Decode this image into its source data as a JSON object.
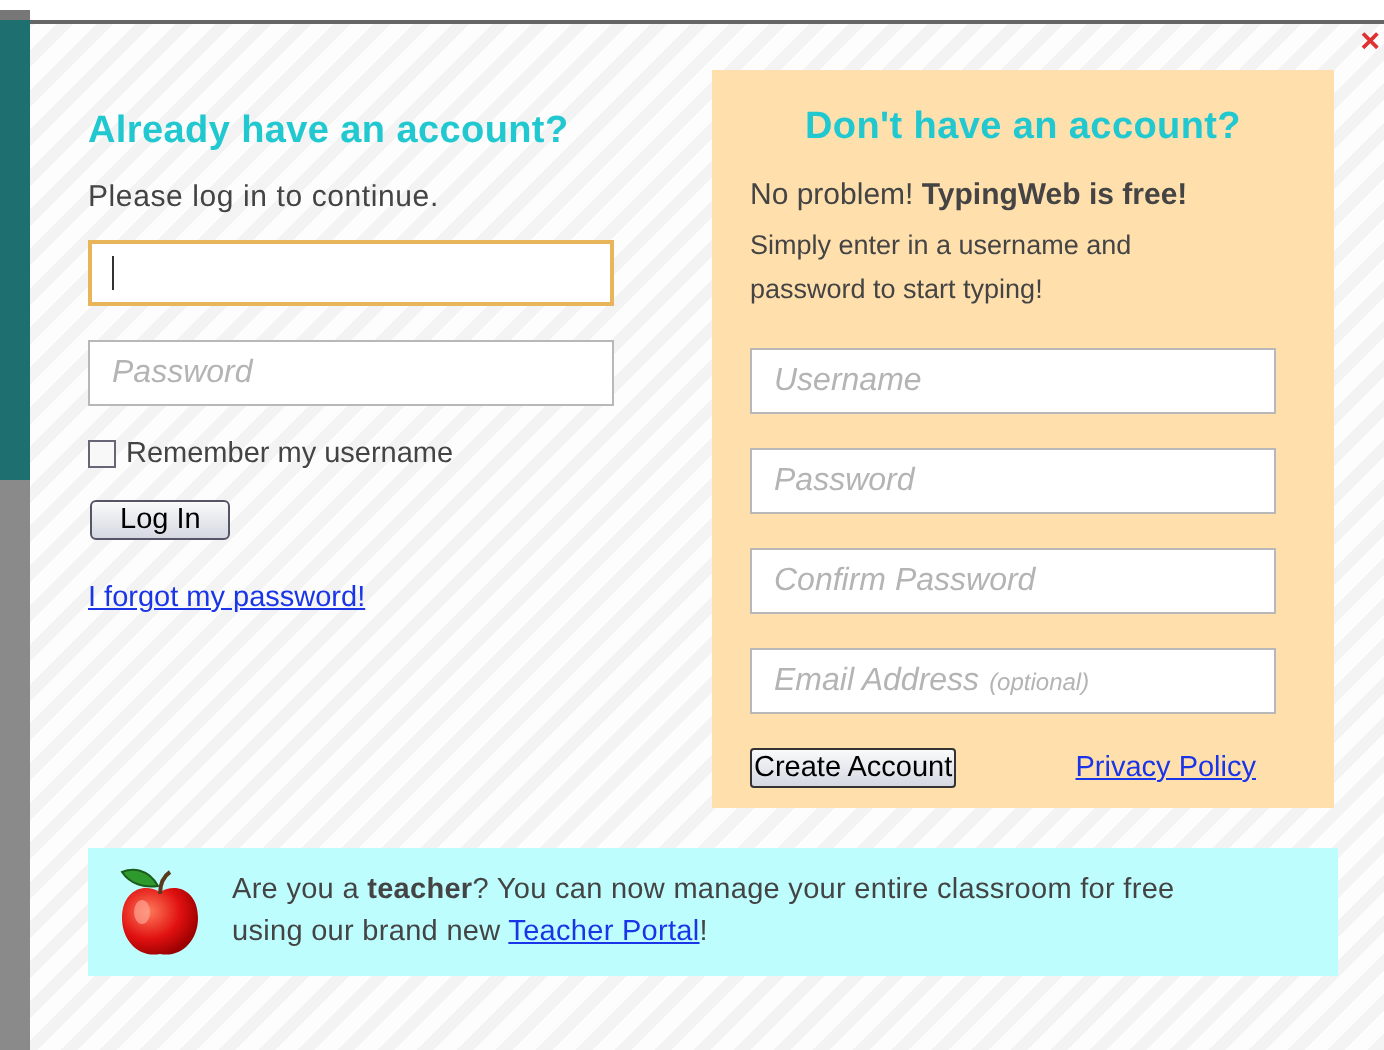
{
  "close_button": {
    "label": "×"
  },
  "login": {
    "title": "Already have an account?",
    "subtitle": "Please log in to continue.",
    "fields": [
      {
        "focused": true
      },
      {
        "placeholder": "Password",
        "focused": false
      }
    ],
    "remember": {
      "label": "Remember my username",
      "checked": false
    },
    "button": "Log In",
    "forgot_link": "I forgot my password!"
  },
  "signup": {
    "title": "Don't have an account?",
    "intro": "No problem! **TypingWeb is free!**",
    "instructions": "Simply enter in a username and password to start typing!",
    "fields": [
      {
        "placeholder": "Username"
      },
      {
        "placeholder": "Password"
      },
      {
        "placeholder": "Confirm Password"
      },
      {
        "placeholder": "Email Address",
        "note": "(optional)"
      }
    ],
    "button": "Create Account",
    "privacy_link": "Privacy Policy"
  },
  "teacher_note": {
    "text": "Are you a **teacher**? You can now manage your entire classroom for free using our brand new ",
    "link": "Teacher Portal",
    "text_end": "!"
  }
}
